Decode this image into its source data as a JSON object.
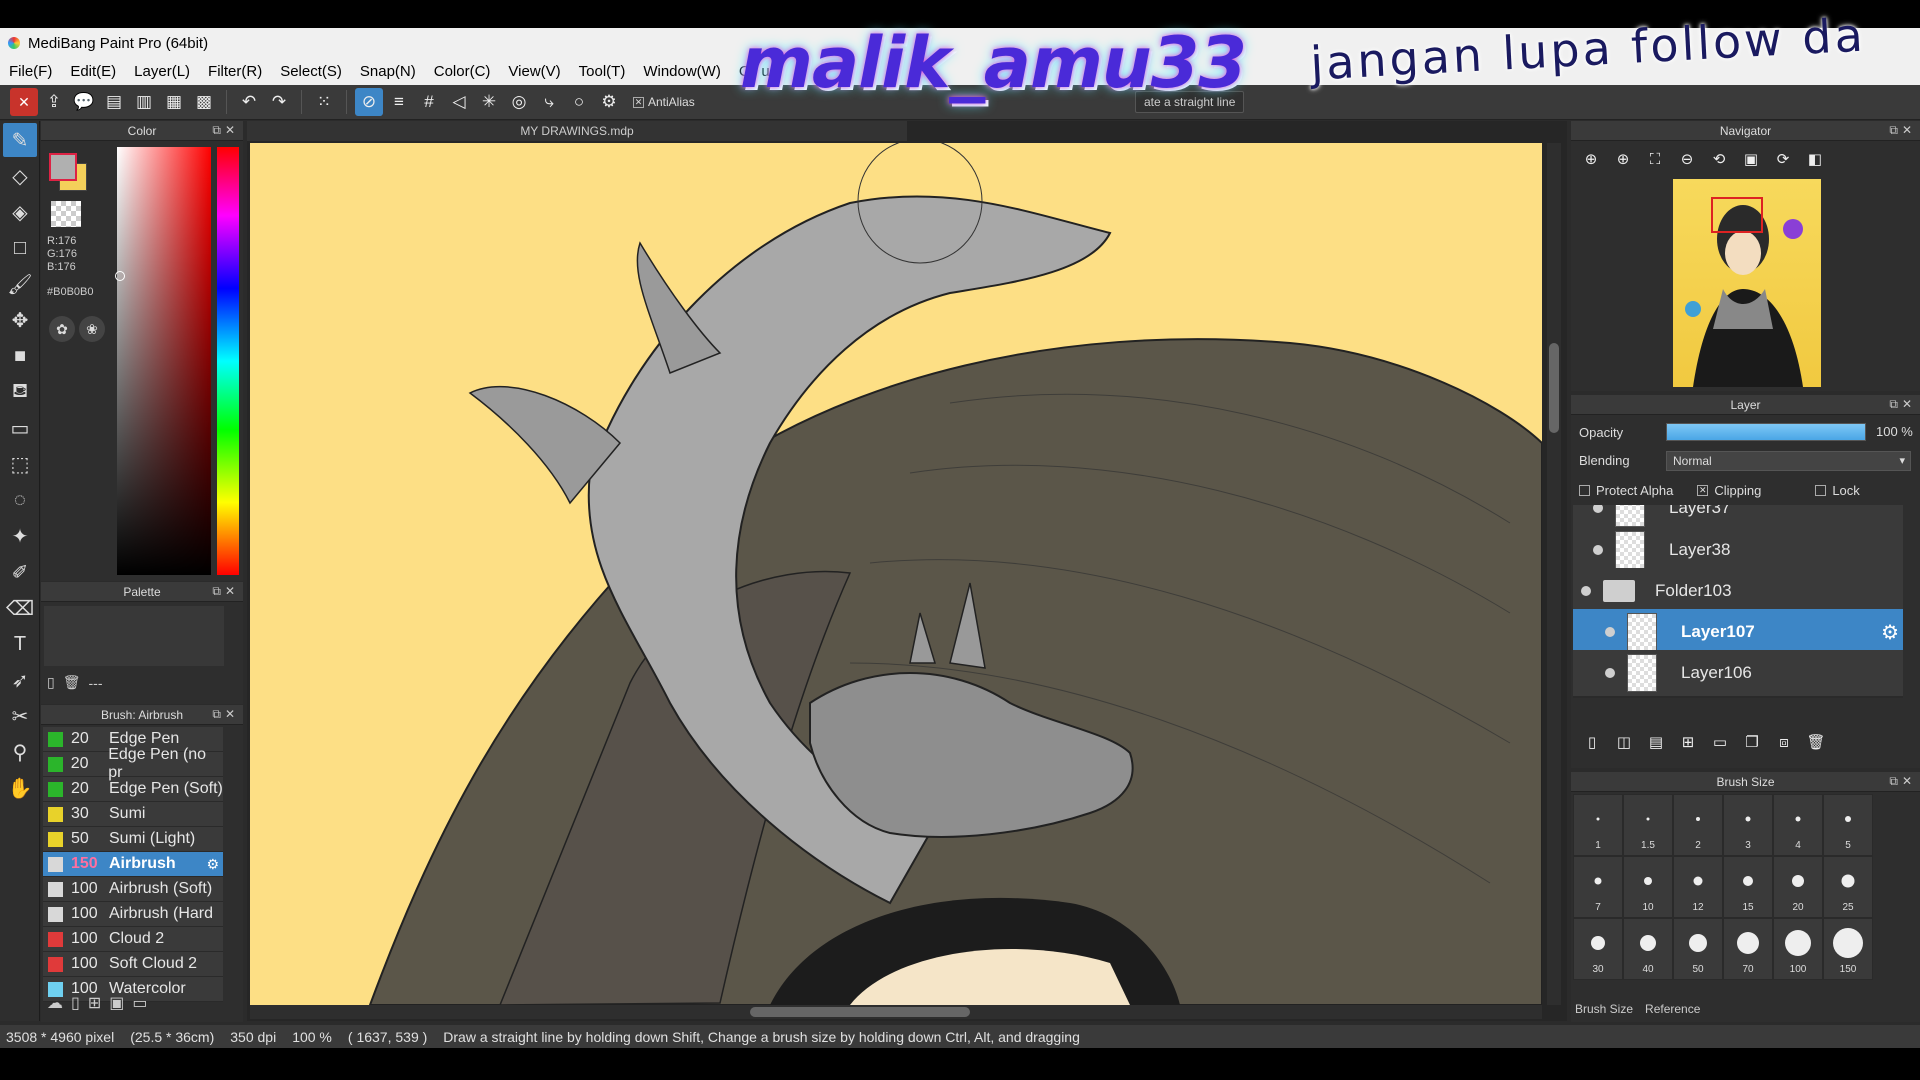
{
  "window": {
    "title": "MediBang Paint Pro (64bit)"
  },
  "menu": [
    "File(F)",
    "Edit(E)",
    "Layer(L)",
    "Filter(R)",
    "Select(S)",
    "Snap(N)",
    "Color(C)",
    "View(V)",
    "Tool(T)",
    "Window(W)",
    "Cloud"
  ],
  "toolbar": {
    "antialias_label": "AntiAlias",
    "hint": "ate a straight line"
  },
  "color_panel": {
    "title": "Color",
    "r": "R:176",
    "g": "G:176",
    "b": "B:176",
    "hex": "#B0B0B0",
    "fg_color": "#b0b0b0"
  },
  "palette_panel": {
    "title": "Palette",
    "footer_text": "---"
  },
  "brush_panel": {
    "title": "Brush: Airbrush",
    "items": [
      {
        "size": "20",
        "name": "Edge Pen",
        "chip": "#2bb52b"
      },
      {
        "size": "20",
        "name": "Edge Pen (no pr",
        "chip": "#2bb52b"
      },
      {
        "size": "20",
        "name": "Edge Pen (Soft)",
        "chip": "#2bb52b"
      },
      {
        "size": "30",
        "name": "Sumi",
        "chip": "#e8d22a"
      },
      {
        "size": "50",
        "name": "Sumi (Light)",
        "chip": "#e8d22a"
      },
      {
        "size": "150",
        "name": "Airbrush",
        "chip": "#d8d8d8",
        "active": true
      },
      {
        "size": "100",
        "name": "Airbrush (Soft)",
        "chip": "#d8d8d8"
      },
      {
        "size": "100",
        "name": "Airbrush (Hard",
        "chip": "#d8d8d8"
      },
      {
        "size": "100",
        "name": "Cloud 2",
        "chip": "#e03a3a"
      },
      {
        "size": "100",
        "name": "Soft Cloud 2",
        "chip": "#e03a3a"
      },
      {
        "size": "100",
        "name": "Watercolor",
        "chip": "#6fd0f0"
      }
    ]
  },
  "canvas": {
    "tab_title": "MY DRAWINGS.mdp",
    "bg": "#fddf85"
  },
  "navigator": {
    "title": "Navigator"
  },
  "layer_panel": {
    "title": "Layer",
    "opacity_label": "Opacity",
    "opacity_value": "100 %",
    "opacity_fraction": 1.0,
    "blending_label": "Blending",
    "blending_value": "Normal",
    "protect_alpha": "Protect Alpha",
    "clipping": "Clipping",
    "lock": "Lock",
    "layers": [
      {
        "name": "Layer37",
        "type": "layer",
        "indent": 1
      },
      {
        "name": "Layer38",
        "type": "layer",
        "indent": 1
      },
      {
        "name": "Folder103",
        "type": "folder",
        "indent": 0
      },
      {
        "name": "Layer107",
        "type": "layer",
        "indent": 2,
        "active": true
      },
      {
        "name": "Layer106",
        "type": "layer",
        "indent": 2
      }
    ]
  },
  "brush_size_panel": {
    "title": "Brush Size",
    "sizes": [
      "1",
      "1.5",
      "2",
      "3",
      "4",
      "5",
      "7",
      "10",
      "12",
      "15",
      "20",
      "25",
      "30",
      "40",
      "50",
      "70",
      "100",
      "150"
    ],
    "tab_size": "Brush Size",
    "tab_reference": "Reference"
  },
  "status": {
    "dimensions": "3508 * 4960 pixel",
    "physical": "(25.5 * 36cm)",
    "dpi": "350 dpi",
    "zoom": "100 %",
    "coords": "( 1637, 539 )",
    "hint": "Draw a straight line by holding down Shift, Change a brush size by holding down Ctrl, Alt, and dragging"
  },
  "overlay": {
    "handle": "malik_amu33",
    "script": "jangan lupa follow da"
  }
}
